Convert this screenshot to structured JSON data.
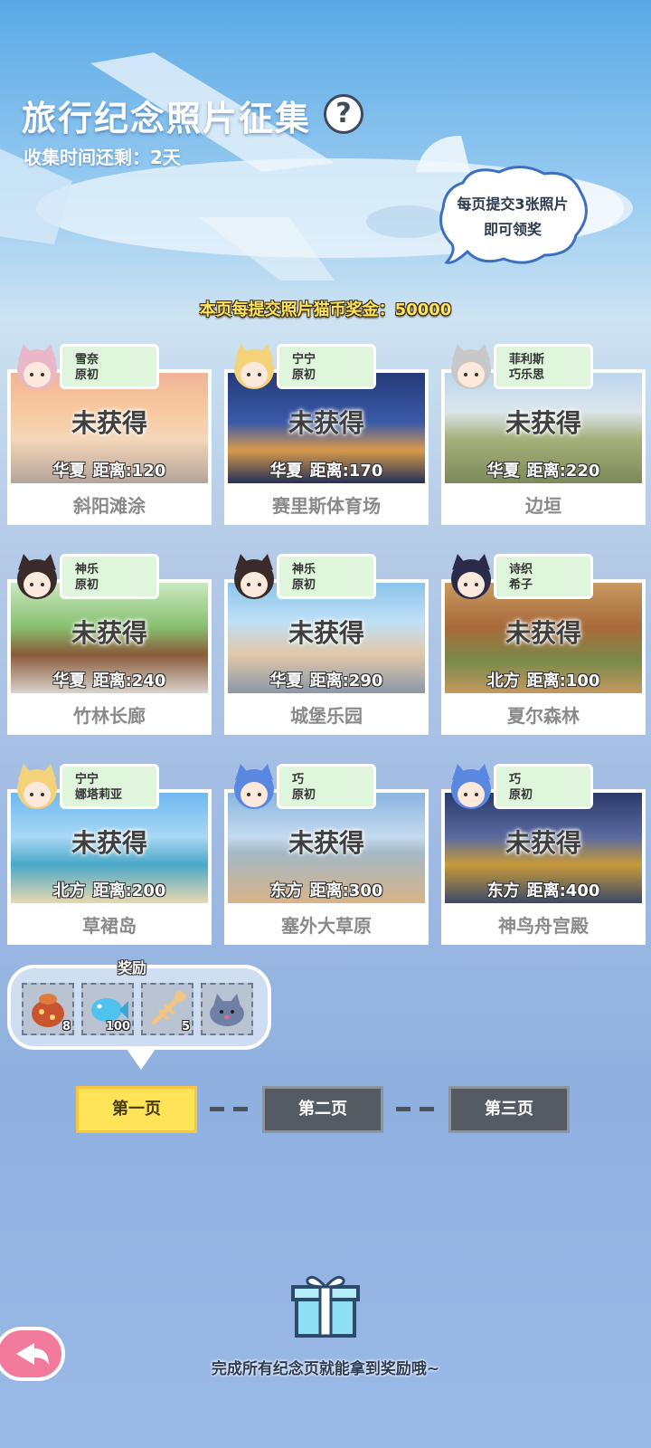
{
  "header": {
    "title": "旅行纪念照片征集",
    "help_icon": "?",
    "time_remaining": "收集时间还剩：2天",
    "bubble_line1": "每页提交3张照片",
    "bubble_line2": "即可领奖",
    "bonus_text": "本页每提交照片猫币奖金：50000"
  },
  "cards": [
    {
      "char1": "雪奈",
      "char2": "原初",
      "status": "未获得",
      "region": "华夏",
      "distance": "距离:120",
      "name": "斜阳滩涂"
    },
    {
      "char1": "宁宁",
      "char2": "原初",
      "status": "未获得",
      "region": "华夏",
      "distance": "距离:170",
      "name": "赛里斯体育场"
    },
    {
      "char1": "菲利斯",
      "char2": "巧乐思",
      "status": "未获得",
      "region": "华夏",
      "distance": "距离:220",
      "name": "边垣"
    },
    {
      "char1": "神乐",
      "char2": "原初",
      "status": "未获得",
      "region": "华夏",
      "distance": "距离:240",
      "name": "竹林长廊"
    },
    {
      "char1": "神乐",
      "char2": "原初",
      "status": "未获得",
      "region": "华夏",
      "distance": "距离:290",
      "name": "城堡乐园"
    },
    {
      "char1": "诗织",
      "char2": "希子",
      "status": "未获得",
      "region": "北方",
      "distance": "距离:100",
      "name": "夏尔森林"
    },
    {
      "char1": "宁宁",
      "char2": "娜塔莉亚",
      "status": "未获得",
      "region": "北方",
      "distance": "距离:200",
      "name": "草裙岛"
    },
    {
      "char1": "巧",
      "char2": "原初",
      "status": "未获得",
      "region": "东方",
      "distance": "距离:300",
      "name": "塞外大草原"
    },
    {
      "char1": "巧",
      "char2": "原初",
      "status": "未获得",
      "region": "东方",
      "distance": "距离:400",
      "name": "神鸟舟宫殿"
    }
  ],
  "reward": {
    "title": "奖励",
    "items": [
      {
        "icon": "fish-bag-icon",
        "count": "8"
      },
      {
        "icon": "blue-fish-icon",
        "count": "100"
      },
      {
        "icon": "fish-bone-icon",
        "count": "5"
      },
      {
        "icon": "cat-plush-icon",
        "count": ""
      }
    ]
  },
  "pages": [
    "第一页",
    "第二页",
    "第三页"
  ],
  "footer": "完成所有纪念页就能拿到奖励哦~",
  "colors": {
    "accent": "#ffe45a",
    "tag_bg": "#dff6dc",
    "inactive_page": "#545b63",
    "back_button": "#f27a9c"
  }
}
